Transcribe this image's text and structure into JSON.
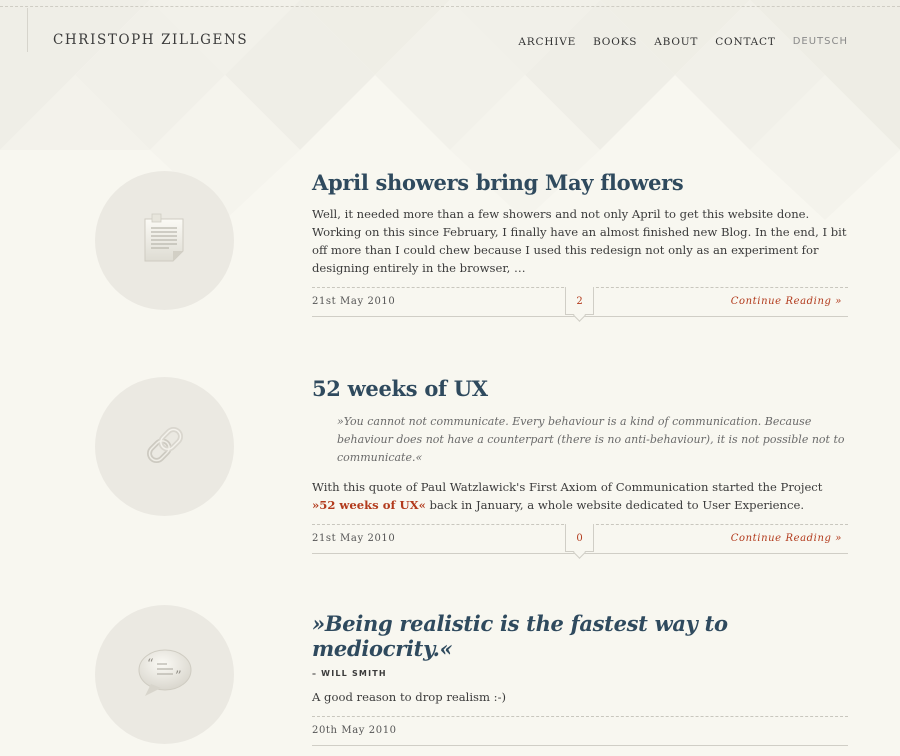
{
  "site": {
    "title": "CHRISTOPH ZILLGENS"
  },
  "nav": {
    "items": [
      "ARCHIVE",
      "BOOKS",
      "ABOUT",
      "CONTACT"
    ],
    "language": "DEUTSCH"
  },
  "posts": [
    {
      "icon": "document-icon",
      "title": "April showers bring May flowers",
      "excerpt": "Well, it needed more than a few showers and not only April to get this website done. Working on this since February, I finally have an almost finished new Blog. In the end, I bit off more than I could chew because I used this redesign not only as an experiment for designing entirely in the browser, …",
      "date": "21st May 2010",
      "comments": "2",
      "more_label": "Continue Reading »"
    },
    {
      "icon": "chain-link-icon",
      "title": "52 weeks of UX",
      "quote": "»You cannot not communicate. Every behaviour is a kind of communication. Because behaviour does not have a counterpart (there is no anti-behaviour), it is not possible not to communicate.«",
      "text_before": "With this quote of Paul Watzlawick's First Axiom of Communication started the Project ",
      "link": "»52 weeks of UX«",
      "text_after": " back in January, a whole website dedicated to User Experience.",
      "date": "21st May 2010",
      "comments": "0",
      "more_label": "Continue Reading »"
    },
    {
      "icon": "quote-bubble-icon",
      "title": "»Being realistic is the fastest way to mediocrity.«",
      "author": "– WILL SMITH",
      "text": "A good reason to drop realism :-)",
      "date": "20th May 2010"
    }
  ],
  "colors": {
    "background": "#f8f7f0",
    "title_blue": "#2f4a5e",
    "accent_red": "#b23a1c",
    "circle": "#ebe9e2"
  }
}
